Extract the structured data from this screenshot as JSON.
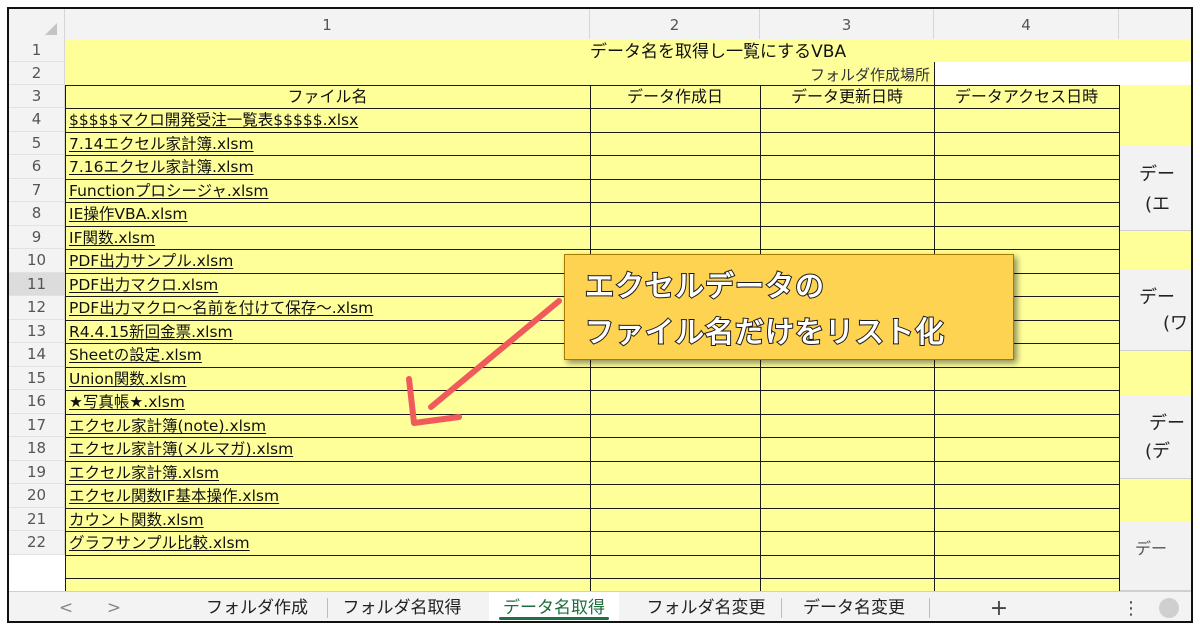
{
  "column_headers": [
    "1",
    "2",
    "3",
    "4"
  ],
  "row_numbers": [
    "1",
    "2",
    "3",
    "4",
    "5",
    "6",
    "7",
    "8",
    "9",
    "10",
    "11",
    "12",
    "13",
    "14",
    "15",
    "16",
    "17",
    "18",
    "19",
    "20",
    "21",
    "22"
  ],
  "sheet": {
    "title": "データ名を取得し一覧にするVBA",
    "folder_label": "フォルダ作成場所",
    "headers": [
      "ファイル名",
      "データ作成日",
      "データ更新日時",
      "データアクセス日時"
    ],
    "files": [
      "$$$$$マクロ開発受注一覧表$$$$$.xlsx",
      "7.14エクセル家計簿.xlsm",
      "7.16エクセル家計簿.xlsm",
      "Functionプロシージャ.xlsm",
      "IE操作VBA.xlsm",
      "IF関数.xlsm",
      "PDF出力サンプル.xlsm",
      "PDF出力マクロ.xlsm",
      "PDF出力マクロ～名前を付けて保存～.xlsm",
      "R4.4.15新回金票.xlsm",
      "Sheetの設定.xlsm",
      "Union関数.xlsm",
      "★写真帳★.xlsm",
      "エクセル家計簿(note).xlsm",
      "エクセル家計簿(メルマガ).xlsm",
      "エクセル家計簿.xlsm",
      "エクセル関数IF基本操作.xlsm",
      "カウント関数.xlsm",
      "グラフサンプル比較.xlsm"
    ]
  },
  "side_buttons": [
    {
      "line1": "デー",
      "line2": "(エ"
    },
    {
      "line1": "デー",
      "line2": "(ワ"
    },
    {
      "line1": "デー",
      "line2": "(デ"
    },
    {
      "line1": "デー",
      "line2": ""
    }
  ],
  "callout": {
    "line1": "エクセルデータの",
    "line2": "ファイル名だけをリスト化"
  },
  "tabs": {
    "prev": "<",
    "next": ">",
    "items": [
      "フォルダ作成",
      "フォルダ名取得",
      "データ名取得",
      "フォルダ名変更",
      "データ名変更"
    ],
    "active_index": 2,
    "add": "+",
    "more": "⋮"
  },
  "colors": {
    "cell_fill": "#ffff9a",
    "callout_fill": "#ffd352",
    "arrow": "#f05a5a",
    "active_tab": "#1e7145"
  }
}
